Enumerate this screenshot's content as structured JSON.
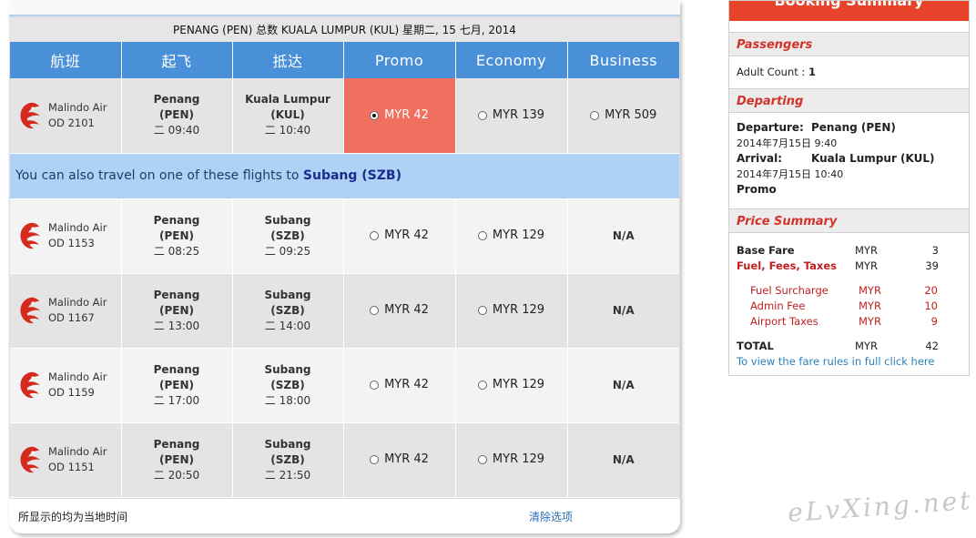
{
  "route_header": "PENANG (PEN) 总数 KUALA LUMPUR (KUL) 星期二, 15 七月, 2014",
  "columns": [
    "航班",
    "起飞",
    "抵达",
    "Promo",
    "Economy",
    "Business"
  ],
  "colors": {
    "header_blue": "#4a90d8",
    "selected_fare": "#f07060",
    "notice_bg": "#aed2f6",
    "summary_red": "#e8442c"
  },
  "flights": [
    {
      "airline": "Malindo Air",
      "flight_no": "OD 2101",
      "dep_city": "Penang",
      "dep_code": "(PEN)",
      "dep_time": "二 09:40",
      "arr_city": "Kuala Lumpur",
      "arr_code": "(KUL)",
      "arr_time": "二 10:40",
      "promo": "MYR 42",
      "economy": "MYR 139",
      "business": "MYR 509"
    },
    {
      "airline": "Malindo Air",
      "flight_no": "OD 1153",
      "dep_city": "Penang",
      "dep_code": "(PEN)",
      "dep_time": "二 08:25",
      "arr_city": "Subang",
      "arr_code": "(SZB)",
      "arr_time": "二 09:25",
      "promo": "MYR 42",
      "economy": "MYR 129",
      "business": "N/A"
    },
    {
      "airline": "Malindo Air",
      "flight_no": "OD 1167",
      "dep_city": "Penang",
      "dep_code": "(PEN)",
      "dep_time": "二 13:00",
      "arr_city": "Subang",
      "arr_code": "(SZB)",
      "arr_time": "二 14:00",
      "promo": "MYR 42",
      "economy": "MYR 129",
      "business": "N/A"
    },
    {
      "airline": "Malindo Air",
      "flight_no": "OD 1159",
      "dep_city": "Penang",
      "dep_code": "(PEN)",
      "dep_time": "二 17:00",
      "arr_city": "Subang",
      "arr_code": "(SZB)",
      "arr_time": "二 18:00",
      "promo": "MYR 42",
      "economy": "MYR 129",
      "business": "N/A"
    },
    {
      "airline": "Malindo Air",
      "flight_no": "OD 1151",
      "dep_city": "Penang",
      "dep_code": "(PEN)",
      "dep_time": "二 20:50",
      "arr_city": "Subang",
      "arr_code": "(SZB)",
      "arr_time": "二 21:50",
      "promo": "MYR 42",
      "economy": "MYR 129",
      "business": "N/A"
    }
  ],
  "notice": {
    "text": "You can also travel on one of these flights to ",
    "code": "Subang (SZB)"
  },
  "footer": {
    "timezone_note": "所显示的均为当地时间",
    "clear_label": "清除选项"
  },
  "summary": {
    "title": "Booking Summary",
    "passengers_head": "Passengers",
    "adult_label": "Adult Count : ",
    "adult_count": "1",
    "departing_head": "Departing",
    "departure_label": "Departure:",
    "departure_city": "Penang (PEN)",
    "departure_datetime": "2014年7月15日 9:40",
    "arrival_label": "Arrival:",
    "arrival_city": "Kuala Lumpur (KUL)",
    "arrival_datetime": "2014年7月15日 10:40",
    "fare_class": "Promo",
    "price_head": "Price Summary",
    "base_fare": {
      "label": "Base Fare",
      "cur": "MYR",
      "amount": "3"
    },
    "fees": {
      "label": "Fuel, Fees, Taxes",
      "cur": "MYR",
      "amount": "39"
    },
    "fuel": {
      "label": "Fuel Surcharge",
      "cur": "MYR",
      "amount": "20"
    },
    "admin": {
      "label": "Admin Fee",
      "cur": "MYR",
      "amount": "10"
    },
    "airport": {
      "label": "Airport Taxes",
      "cur": "MYR",
      "amount": "9"
    },
    "total": {
      "label": "TOTAL",
      "cur": "MYR",
      "amount": "42"
    },
    "rules_link": "To view the fare rules in full click here"
  },
  "watermark": "eLvXing.net"
}
